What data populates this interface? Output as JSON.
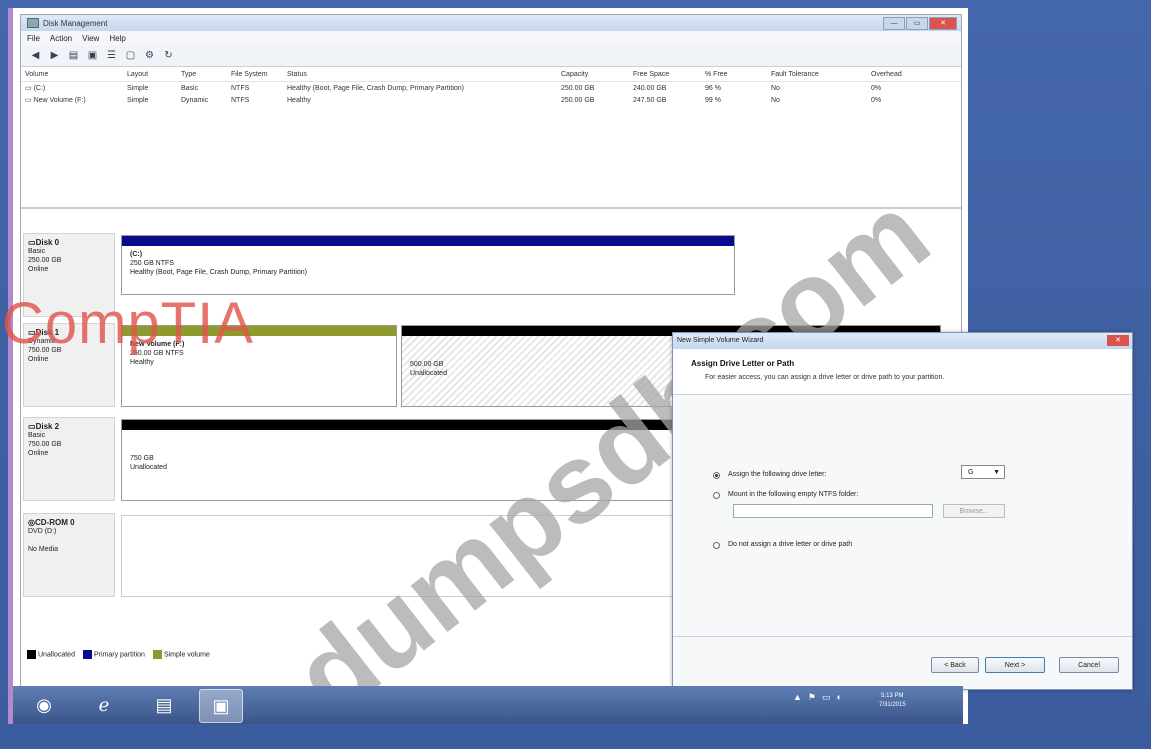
{
  "window": {
    "title": "Disk Management",
    "controls": [
      "—",
      "▭",
      "✕"
    ]
  },
  "menu": [
    "File",
    "Action",
    "View",
    "Help"
  ],
  "volume_table": {
    "headers": [
      "Volume",
      "Layout",
      "Type",
      "File System",
      "Status",
      "Capacity",
      "Free Space",
      "% Free",
      "Fault Tolerance",
      "Overhead"
    ],
    "rows": [
      [
        "(C:)",
        "Simple",
        "Basic",
        "NTFS",
        "Healthy (Boot, Page File, Crash Dump, Primary Partition)",
        "250.00 GB",
        "240.00 GB",
        "96 %",
        "No",
        "0%"
      ],
      [
        "New Volume (F:)",
        "Simple",
        "Dynamic",
        "NTFS",
        "Healthy",
        "250.00 GB",
        "247.50 GB",
        "99 %",
        "No",
        "0%"
      ]
    ]
  },
  "disks": [
    {
      "name": "Disk 0",
      "type": "Basic",
      "size": "250.00 GB",
      "state": "Online",
      "part": {
        "title": "(C:)",
        "line1": "250 GB NTFS",
        "line2": "Healthy (Boot, Page File, Crash Dump, Primary Partition)"
      }
    },
    {
      "name": "Disk 1",
      "type": "Dynamic",
      "size": "750.00 GB",
      "state": "Online",
      "part": {
        "title": "New Volume (F:)",
        "line1": "250.00 GB NTFS",
        "line2": "Healthy"
      },
      "unalloc": {
        "line1": "500.00 GB",
        "line2": "Unallocated"
      }
    },
    {
      "name": "Disk 2",
      "type": "Basic",
      "size": "750.00 GB",
      "state": "Online",
      "unalloc": {
        "line1": "750 GB",
        "line2": "Unallocated"
      }
    },
    {
      "name": "CD-ROM 0",
      "type": "DVD (D:)",
      "size": "",
      "state": "No Media"
    }
  ],
  "legend": [
    "Unallocated",
    "Primary partition",
    "Simple volume"
  ],
  "colors": {
    "unallocated": "#000000",
    "primary": "#0a0a8c",
    "simple": "#8e9a2c"
  },
  "wizard": {
    "title": "New Simple Volume Wizard",
    "heading": "Assign Drive Letter or Path",
    "subheading": "For easier access, you can assign a drive letter or drive path to your partition.",
    "opt_assign": "Assign the following drive letter:",
    "opt_mount": "Mount in the following empty NTFS folder:",
    "opt_none": "Do not assign a drive letter or drive path",
    "drive_letter": "G",
    "browse": "Browse...",
    "back": "< Back",
    "next": "Next >",
    "cancel": "Cancel"
  },
  "watermark": {
    "brand": "CompTIA",
    "site": "dumpsdb.com"
  },
  "taskbar": {
    "time": "5:13 PM",
    "date": "7/31/2015"
  }
}
